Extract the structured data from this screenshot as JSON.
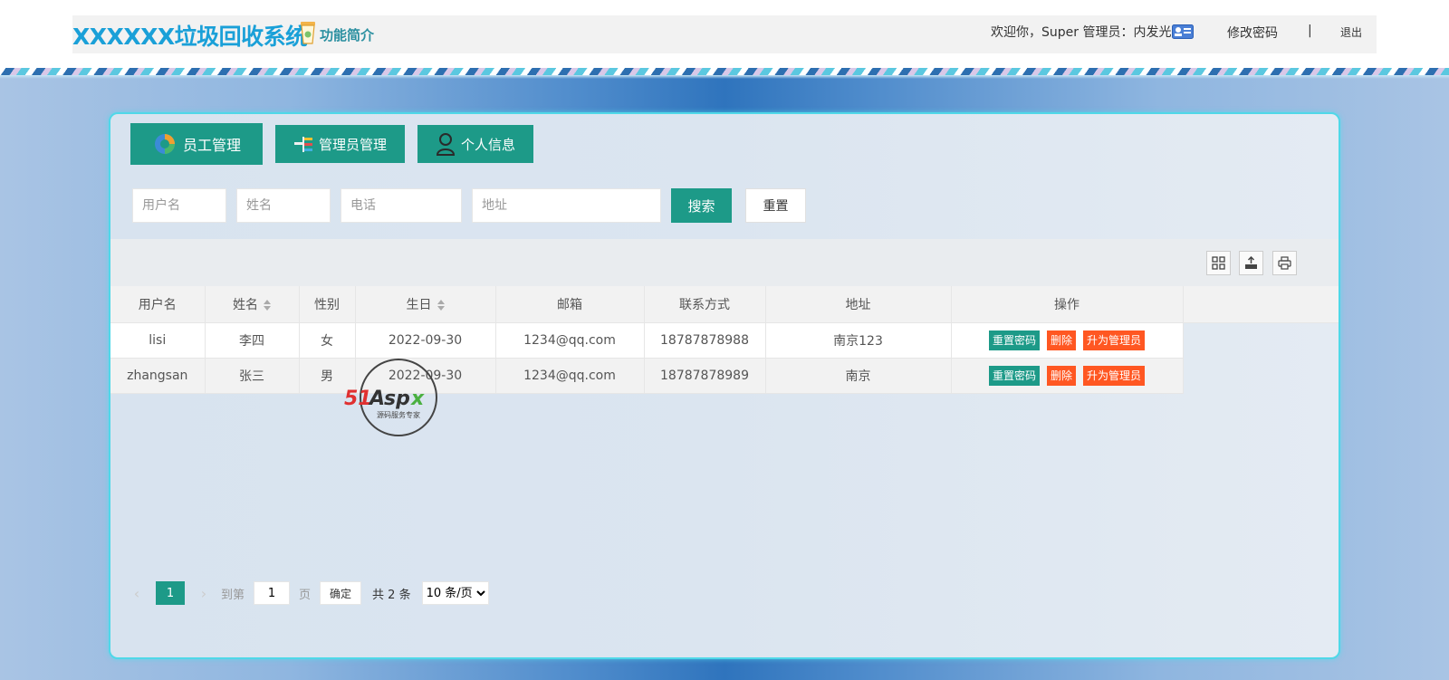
{
  "header": {
    "title": "XXXXXX垃圾回收系统",
    "intro_label": "功能简介",
    "welcome": "欢迎你，Super 管理员：内发光",
    "change_password": "修改密码",
    "separator": "|",
    "logout": "退出"
  },
  "tabs": [
    {
      "label": "员工管理",
      "icon": "employee-icon"
    },
    {
      "label": "管理员管理",
      "icon": "admin-icon"
    },
    {
      "label": "个人信息",
      "icon": "person-icon"
    }
  ],
  "search": {
    "username_placeholder": "用户名",
    "name_placeholder": "姓名",
    "phone_placeholder": "电话",
    "address_placeholder": "地址",
    "search_label": "搜索",
    "reset_label": "重置"
  },
  "toolbar": {
    "icons": [
      "columns-icon",
      "export-icon",
      "print-icon"
    ]
  },
  "table": {
    "headers": [
      "用户名",
      "姓名",
      "性别",
      "生日",
      "邮箱",
      "联系方式",
      "地址",
      "操作"
    ],
    "rows": [
      {
        "username": "lisi",
        "name": "李四",
        "gender": "女",
        "birthday": "2022-09-30",
        "email": "1234@qq.com",
        "phone": "18787878988",
        "address": "南京123"
      },
      {
        "username": "zhangsan",
        "name": "张三",
        "gender": "男",
        "birthday": "2022-09-30",
        "email": "1234@qq.com",
        "phone": "18787878989",
        "address": "南京"
      }
    ],
    "actions": {
      "reset_password": "重置密码",
      "delete": "删除",
      "promote": "升为管理员"
    }
  },
  "pager": {
    "prev": "‹",
    "current_page": "1",
    "next": "›",
    "goto_prefix": "到第",
    "goto_value": "1",
    "goto_suffix": "页",
    "confirm": "确定",
    "total": "共 2 条",
    "page_size": "10 条/页"
  },
  "watermark": {
    "brand": "51Aspx",
    "tagline": "源码服务专家"
  },
  "colors": {
    "primary": "#1d9a88",
    "danger": "#ff5722",
    "title": "#1aa0d8",
    "panel_border": "#4fd8e8"
  }
}
